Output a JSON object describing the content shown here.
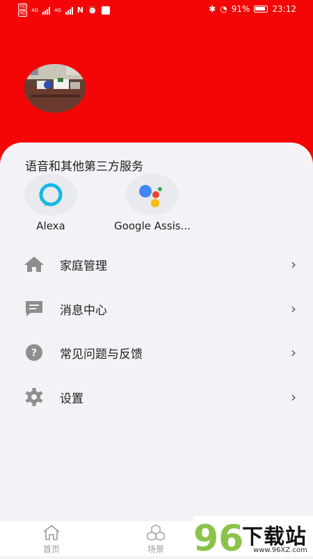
{
  "status_bar": {
    "sim1": "HD",
    "sim2": "HD",
    "network1": "4G",
    "network2": "4G",
    "battery_percent": "91%",
    "time": "23:12"
  },
  "colors": {
    "header_bg": "#f50606",
    "card_bg": "#f3f3f7",
    "icon_gray": "#8e8e8e"
  },
  "section_title": "语音和其他第三方服务",
  "services": [
    {
      "label": "Alexa",
      "icon": "alexa-icon"
    },
    {
      "label": "Google Assis...",
      "icon": "google-assistant-icon"
    }
  ],
  "menu": [
    {
      "label": "家庭管理",
      "icon": "home-icon"
    },
    {
      "label": "消息中心",
      "icon": "message-icon"
    },
    {
      "label": "常见问题与反馈",
      "icon": "help-icon"
    },
    {
      "label": "设置",
      "icon": "gear-icon"
    }
  ],
  "bottom_nav": [
    {
      "label": "首页",
      "icon": "home-outline-icon"
    },
    {
      "label": "场景",
      "icon": "scene-icon"
    }
  ],
  "watermark": {
    "logo": "96",
    "text": "下载站",
    "url": "www.96XZ.com"
  }
}
